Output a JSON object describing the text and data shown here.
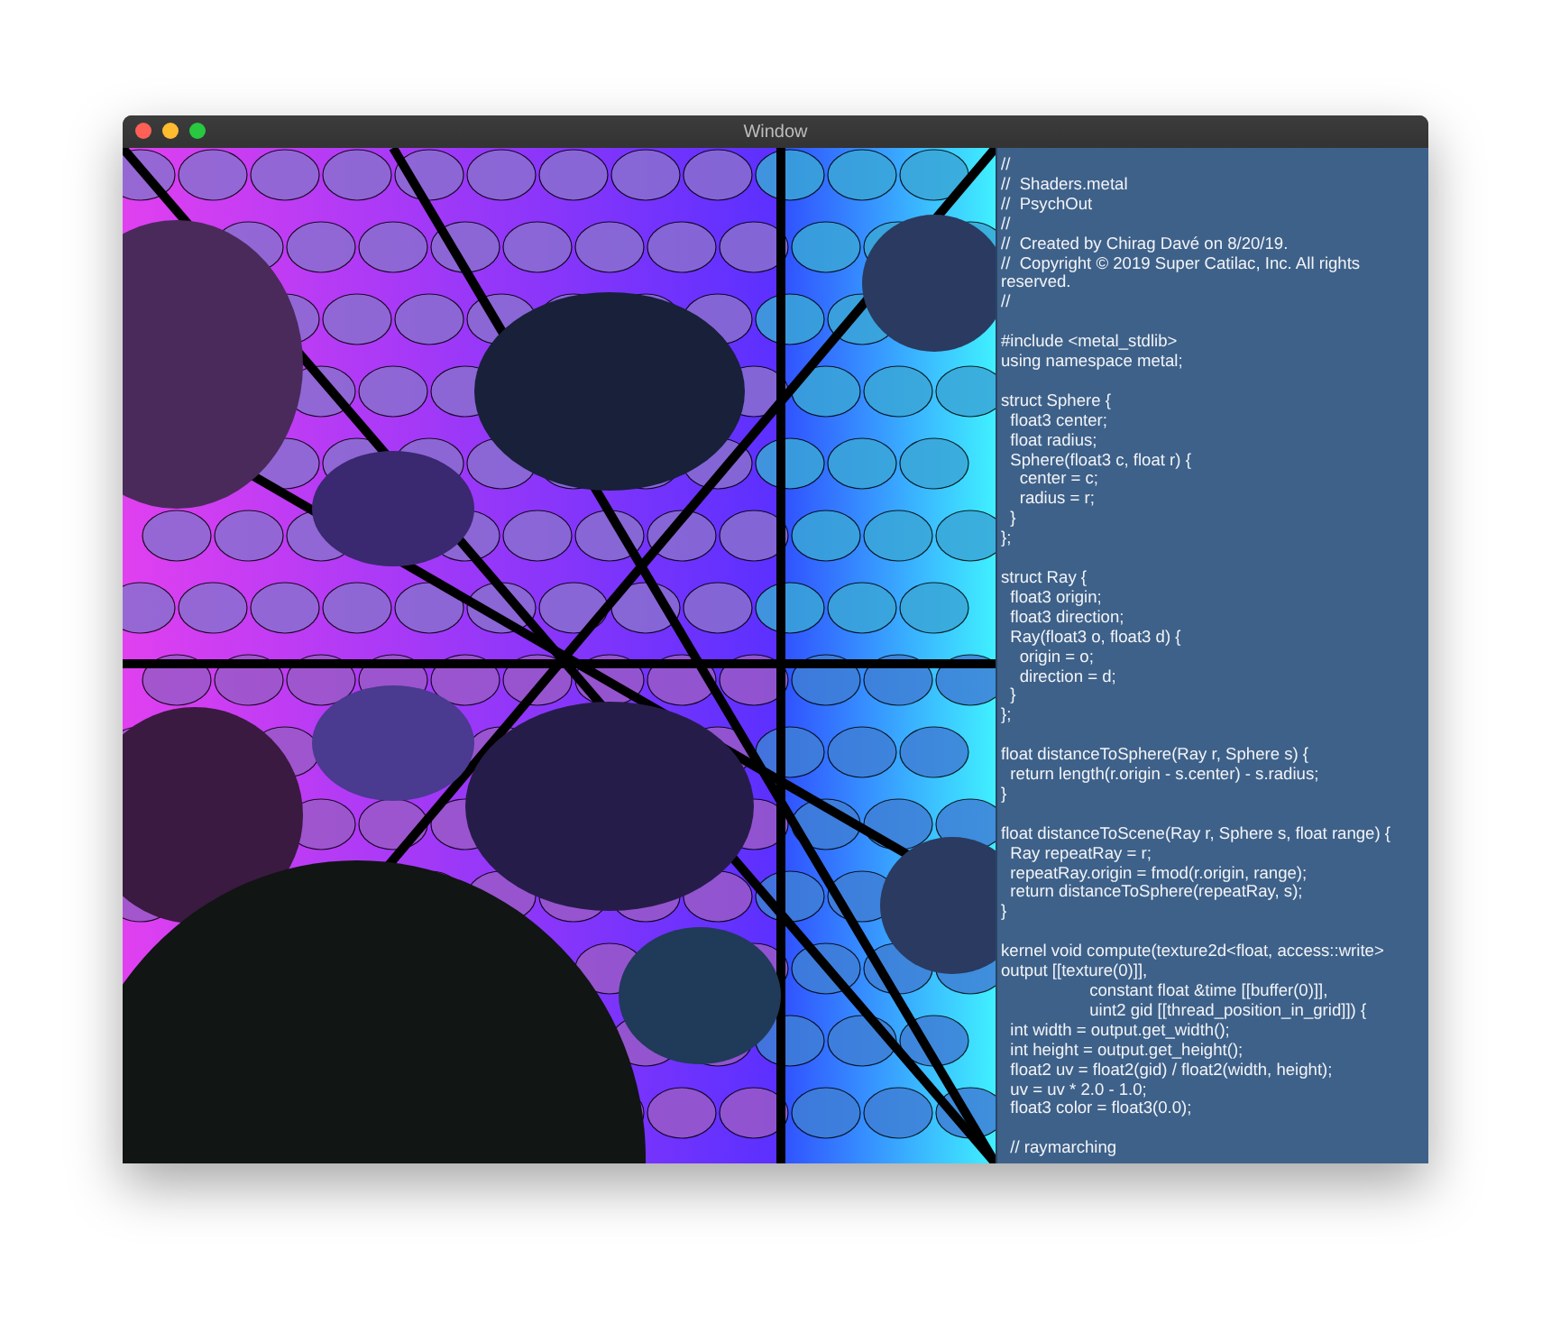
{
  "window": {
    "title": "Window"
  },
  "code": {
    "blocks": [
      [
        "//",
        "//  Shaders.metal",
        "//  PsychOut",
        "//",
        "//  Created by Chirag Davé on 8/20/19.",
        "//  Copyright © 2019 Super Catilac, Inc. All rights reserved.",
        "//"
      ],
      [
        "#include <metal_stdlib>",
        "using namespace metal;"
      ],
      [
        "struct Sphere {",
        "  float3 center;",
        "  float radius;",
        "  Sphere(float3 c, float r) {",
        "    center = c;",
        "    radius = r;",
        "  }",
        "};"
      ],
      [
        "struct Ray {",
        "  float3 origin;",
        "  float3 direction;",
        "  Ray(float3 o, float3 d) {",
        "    origin = o;",
        "    direction = d;",
        "  }",
        "};"
      ],
      [
        "float distanceToSphere(Ray r, Sphere s) {",
        "  return length(r.origin - s.center) - s.radius;",
        "}"
      ],
      [
        "float distanceToScene(Ray r, Sphere s, float range) {",
        "  Ray repeatRay = r;",
        "  repeatRay.origin = fmod(r.origin, range);",
        "  return distanceToSphere(repeatRay, s);",
        "}"
      ],
      [
        "kernel void compute(texture2d<float, access::write> output [[texture(0)]],",
        "                   constant float &time [[buffer(0)]],",
        "                   uint2 gid [[thread_position_in_grid]]) {",
        "  int width = output.get_width();",
        "  int height = output.get_height();",
        "  float2 uv = float2(gid) / float2(width, height);",
        "  uv = uv * 2.0 - 1.0;",
        "  float3 color = float3(0.0);"
      ],
      [
        "  // raymarching"
      ]
    ]
  }
}
